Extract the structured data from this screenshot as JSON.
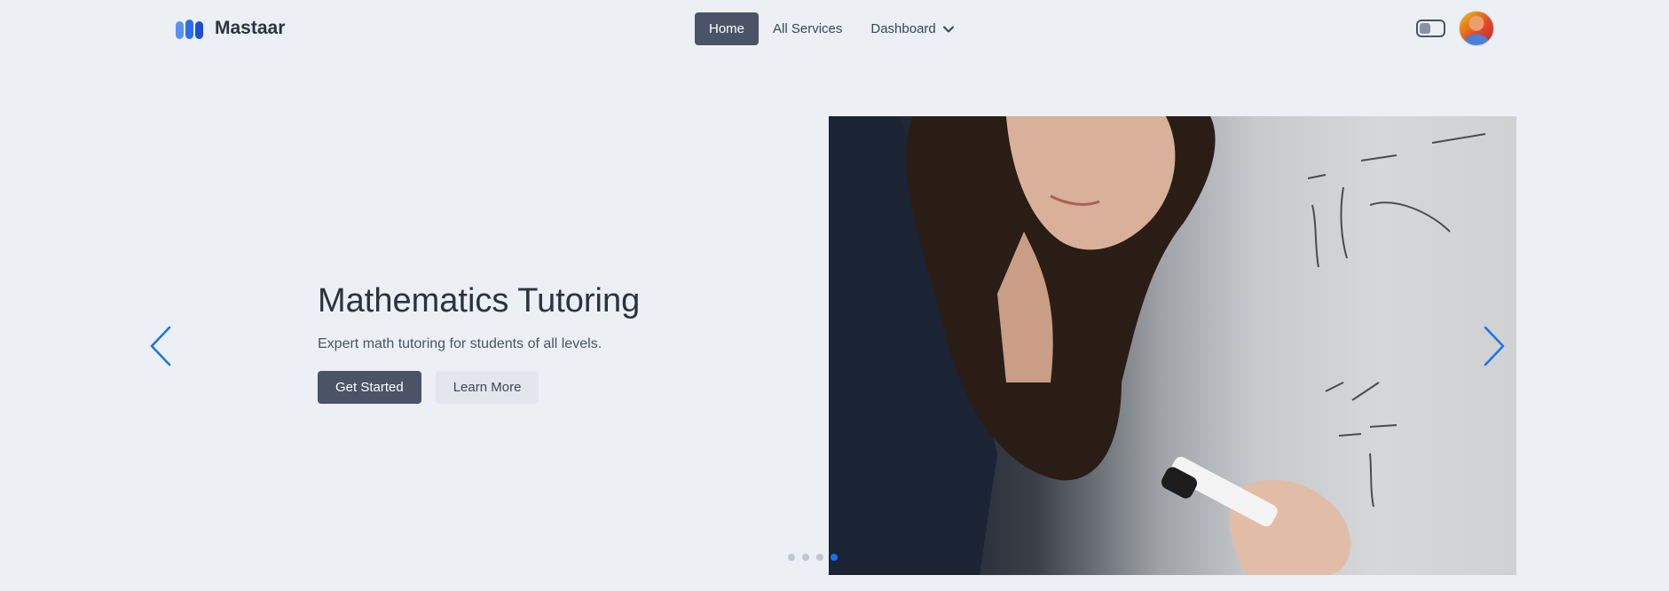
{
  "brand": {
    "name": "Mastaar",
    "logo_icon": "brand-logo-icon",
    "logo_color": "#2f6df0"
  },
  "nav": {
    "items": [
      {
        "label": "Home",
        "active": true
      },
      {
        "label": "All Services",
        "active": false
      },
      {
        "label": "Dashboard",
        "active": false,
        "icon": "chevron-down-icon"
      }
    ]
  },
  "header_right": {
    "theme_toggle": "toggle-icon",
    "avatar": "user-avatar"
  },
  "carousel": {
    "slide": {
      "title": "Mathematics Tutoring",
      "subtitle": "Expert math tutoring for students of all levels.",
      "primary_button": "Get Started",
      "secondary_button": "Learn More",
      "image": "woman writing math equations on whiteboard"
    },
    "prev_icon": "chevron-left-icon",
    "next_icon": "chevron-right-icon",
    "indicator_count": 4,
    "active_indicator": 4
  },
  "colors": {
    "background": "#eceff4",
    "primary_button": "#4a5466",
    "accent": "#1a73e8",
    "text": "#2b3240"
  }
}
